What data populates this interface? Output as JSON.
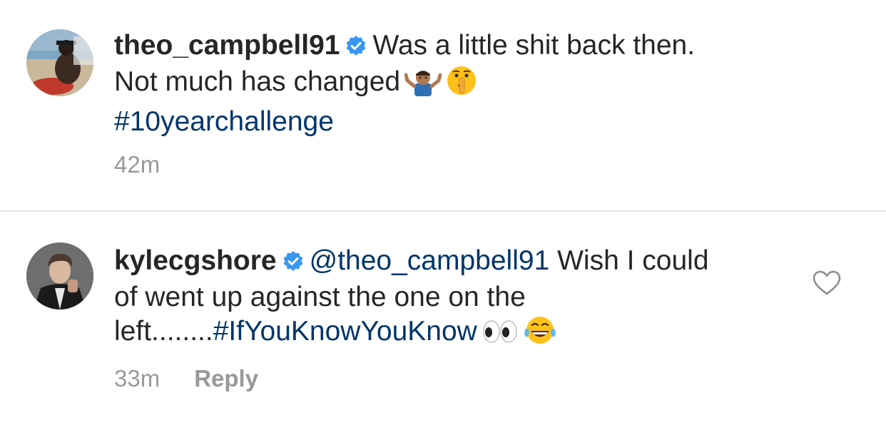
{
  "comments": [
    {
      "username": "theo_campbell91",
      "verified": true,
      "text_line1": "Was a little shit back then.",
      "text_line2": "Not much has changed",
      "emojis": [
        "person-shrugging-emoji",
        "shushing-face-emoji"
      ],
      "hashtag": "#10yearchallenge",
      "time": "42m"
    },
    {
      "username": "kylecgshore",
      "verified": true,
      "mention": "@theo_campbell91",
      "text_part1": " Wish I could",
      "text_part2": "of went up against the one on the",
      "text_part3": "left........",
      "hashtag": "#IfYouKnowYouKnow",
      "emojis": [
        "eyes-emoji",
        "tears-of-joy-emoji"
      ],
      "time": "33m",
      "reply_label": "Reply"
    }
  ],
  "colors": {
    "text": "#262626",
    "hashtag": "#003569",
    "meta": "#999999",
    "verified": "#3897f0",
    "divider": "#e3e3e3"
  }
}
